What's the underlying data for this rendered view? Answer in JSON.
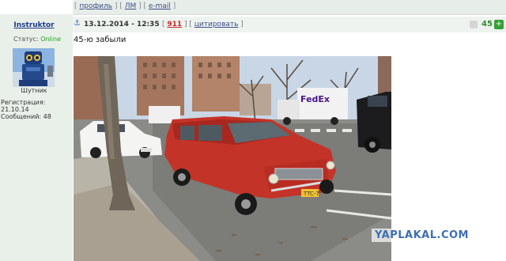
{
  "toplinks": {
    "profile": "профиль",
    "pm": "ЛМ",
    "email": "e-mail"
  },
  "user": {
    "name": "Instruktor",
    "status_label": "Статус:",
    "status_value": "Online",
    "title": "Шутник",
    "registration": "Регистрация: 21.10.14",
    "messages": "Сообщений: 48"
  },
  "post": {
    "date": "13.12.2014 - 12:35",
    "number": "911",
    "quote_label": "цитировать",
    "text": "45-ю забыли",
    "rating": "45"
  },
  "image": {
    "van_text": "FedEx",
    "plate_text": "TTC-7",
    "watermark": "YAPLAKAL.COM"
  },
  "colors": {
    "accent_green": "#34a034",
    "link": "#1a3b8c",
    "red_number": "#c62828"
  }
}
